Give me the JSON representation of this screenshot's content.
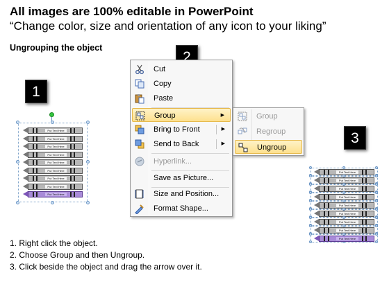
{
  "header": {
    "title": "All images are 100% editable in PowerPoint",
    "subtitle": "“Change color, size and orientation of any icon to your liking”",
    "section_title": "Ungrouping the object"
  },
  "steps_badges": [
    "1",
    "2",
    "3"
  ],
  "crayon_label": "Put Text Here",
  "crayons": [
    {
      "color": "gray"
    },
    {
      "color": "gray"
    },
    {
      "color": "gray"
    },
    {
      "color": "gray"
    },
    {
      "color": "gray"
    },
    {
      "color": "gray"
    },
    {
      "color": "gray"
    },
    {
      "color": "gray"
    },
    {
      "color": "purple"
    }
  ],
  "context_menu": {
    "items": [
      {
        "label": "Cut",
        "icon": "scissors-icon"
      },
      {
        "label": "Copy",
        "icon": "copy-icon"
      },
      {
        "label": "Paste",
        "icon": "paste-icon"
      },
      {
        "label": "Group",
        "icon": "group-icon",
        "highlighted": true,
        "submenu": true
      },
      {
        "label": "Bring to Front",
        "icon": "bring-to-front-icon",
        "submenu": true
      },
      {
        "label": "Send to Back",
        "icon": "send-to-back-icon",
        "submenu": true
      },
      {
        "label": "Hyperlink...",
        "icon": "hyperlink-icon",
        "disabled": true
      },
      {
        "label": "Save as Picture...",
        "icon": "none"
      },
      {
        "label": "Size and Position...",
        "icon": "size-position-icon"
      },
      {
        "label": "Format Shape...",
        "icon": "format-shape-icon"
      }
    ]
  },
  "group_submenu": {
    "items": [
      {
        "label": "Group",
        "icon": "group-icon",
        "disabled": true
      },
      {
        "label": "Regroup",
        "icon": "regroup-icon",
        "disabled": true
      },
      {
        "label": "Ungroup",
        "icon": "ungroup-icon",
        "highlighted": true
      }
    ]
  },
  "instructions": [
    "1.   Right click the object.",
    "2.   Choose Group and then Ungroup.",
    "3.   Click beside the object and drag the arrow over it."
  ],
  "colors": {
    "highlight_top": "#fff3c8",
    "highlight_bottom": "#fde08e",
    "crayon_gray": "#b8b8b8",
    "crayon_purple": "#a88ad8",
    "selection_blue": "#6b95c4",
    "rotate_green": "#34c540"
  }
}
